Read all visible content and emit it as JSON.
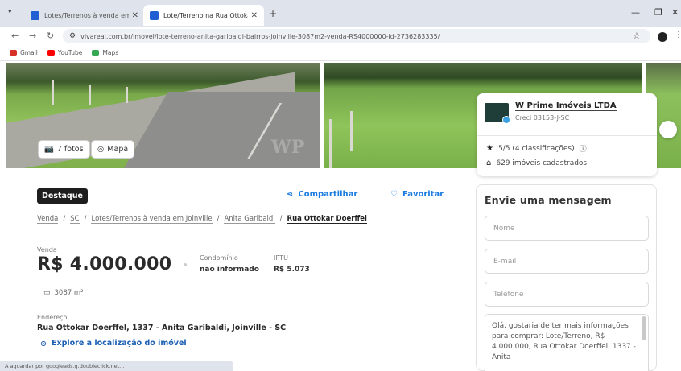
{
  "browser": {
    "tabs": [
      {
        "title": "Lotes/Terrenos à venda em Joinville",
        "active": false
      },
      {
        "title": "Lote/Terreno na Rua Ottokar D...",
        "active": true
      }
    ],
    "url": "vivareal.com.br/imovel/lote-terreno-anita-garibaldi-bairros-joinville-3087m2-venda-RS4000000-id-2736283335/",
    "bookmarks": [
      {
        "label": "Gmail",
        "color": "#d93025"
      },
      {
        "label": "YouTube",
        "color": "#ff0000"
      },
      {
        "label": "Maps",
        "color": "#34a853"
      }
    ],
    "status_text": "A aguardar por googleads.g.doubleclick.net..."
  },
  "gallery": {
    "photos_label": "7 fotos",
    "map_label": "Mapa",
    "watermark": "WP"
  },
  "advertiser": {
    "name": "W Prime Imóveis LTDA",
    "creci": "Creci 03153-J-SC",
    "rating": "5/5 (4 classificações)",
    "listings": "629 imóveis cadastrados"
  },
  "listing": {
    "badge": "Destaque",
    "share_label": "Compartilhar",
    "favorite_label": "Favoritar",
    "breadcrumbs": [
      "Venda",
      "SC",
      "Lotes/Terrenos à venda em Joinville",
      "Anita Garibaldi"
    ],
    "breadcrumb_current": "Rua Ottokar Doerffel",
    "sale_label": "Venda",
    "price": "R$ 4.000.000",
    "condo_label": "Condomínio",
    "condo_value": "não informado",
    "iptu_label": "IPTU",
    "iptu_value": "R$ 5.073",
    "area": "3087 m²",
    "address_label": "Endereço",
    "address": "Rua Ottokar Doerffel, 1337 - Anita Garibaldi, Joinville - SC",
    "explore_label": "Explore a localização do imóvel"
  },
  "contact": {
    "title": "Envie uma mensagem",
    "name_placeholder": "Nome",
    "email_placeholder": "E-mail",
    "phone_placeholder": "Telefone",
    "message": "Olá, gostaria de ter mais informações para comprar: Lote/Terreno, R$ 4.000.000, Rua Ottokar Doerffel, 1337 - Anita"
  }
}
